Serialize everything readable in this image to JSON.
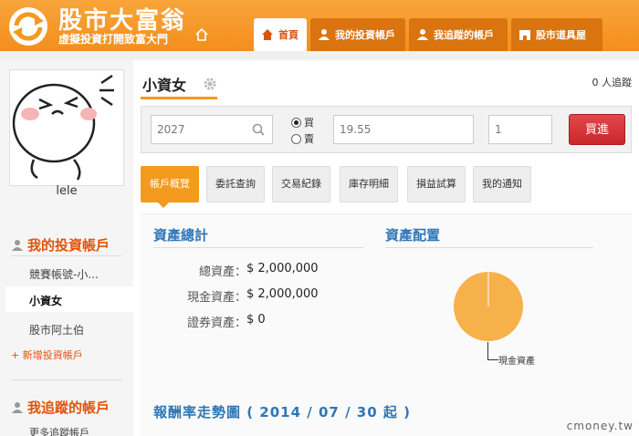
{
  "header": {
    "brand": "股市大富翁",
    "slogan": "虛擬投資打開致富大門",
    "nav": [
      {
        "label": "首頁",
        "icon": "home-icon",
        "active": true
      },
      {
        "label": "我的投資帳戶",
        "icon": "person-icon",
        "active": false
      },
      {
        "label": "我追蹤的帳戶",
        "icon": "person-icon",
        "active": false
      },
      {
        "label": "股市道具屋",
        "icon": "shop-icon",
        "active": false
      }
    ]
  },
  "sidebar": {
    "username": "lele",
    "my_accounts_title": "我的投資帳戶",
    "accounts": [
      "競賽帳號-小...",
      "小資女",
      "股市阿土伯"
    ],
    "add_account": "+ 新增投資帳戶",
    "tracked_title": "我追蹤的帳戶",
    "more_tracked": "更多追蹤帳戶"
  },
  "main": {
    "account_name": "小資女",
    "followers": "0 人追蹤",
    "trade": {
      "stock_code": "2027",
      "side_buy": "買",
      "side_sell": "賣",
      "price": "19.55",
      "quantity": "1",
      "submit": "買進"
    },
    "tabs": [
      "帳戶概覽",
      "委託查詢",
      "交易紀錄",
      "庫存明細",
      "損益試算",
      "我的通知"
    ],
    "asset_total_title": "資產總計",
    "asset_alloc_title": "資產配置",
    "assets": [
      {
        "label": "總資產：",
        "value": "$ 2,000,000"
      },
      {
        "label": "現金資產：",
        "value": "$ 2,000,000"
      },
      {
        "label": "證券資產：",
        "value": "$ 0"
      }
    ],
    "pie_label": "現金資產",
    "return_title": "報酬率走勢圖 ( 2014 / 07 / 30 起 )"
  },
  "watermark": "cmoney.tw",
  "colors": {
    "accent": "#f39a1f",
    "brand": "#e2520b",
    "heading": "#2f76b6",
    "buy": "#d0353a"
  }
}
